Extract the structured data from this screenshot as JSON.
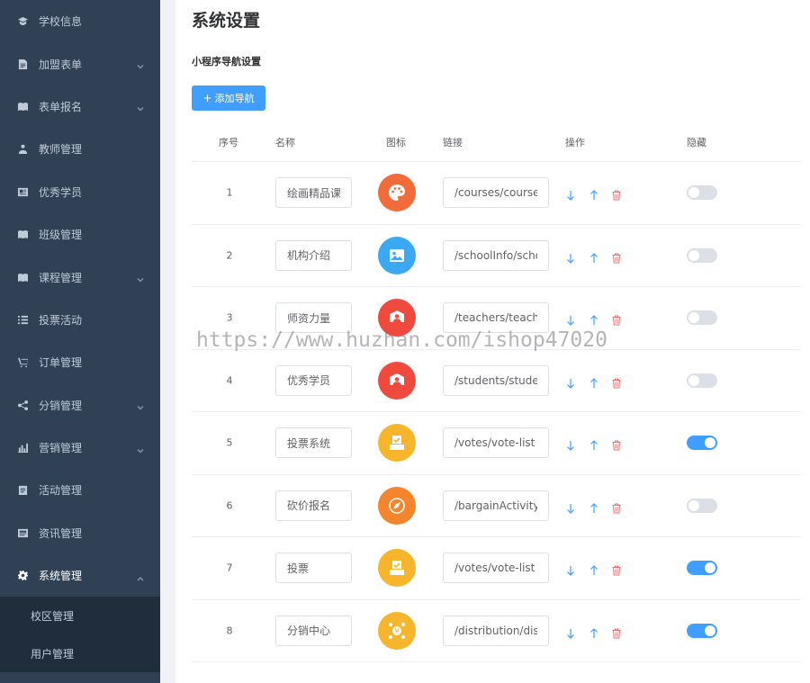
{
  "sidebar": {
    "items": [
      {
        "label": "学校信息",
        "icon": "graduation-cap-icon",
        "has_children": false
      },
      {
        "label": "加盟表单",
        "icon": "form-icon",
        "has_children": true
      },
      {
        "label": "表单报名",
        "icon": "book-open-icon",
        "has_children": true
      },
      {
        "label": "教师管理",
        "icon": "users-icon",
        "has_children": false
      },
      {
        "label": "优秀学员",
        "icon": "id-card-icon",
        "has_children": false
      },
      {
        "label": "班级管理",
        "icon": "book-icon",
        "has_children": false
      },
      {
        "label": "课程管理",
        "icon": "book-icon",
        "has_children": true
      },
      {
        "label": "投票活动",
        "icon": "list-icon",
        "has_children": false
      },
      {
        "label": "订单管理",
        "icon": "cart-icon",
        "has_children": false
      },
      {
        "label": "分销管理",
        "icon": "share-icon",
        "has_children": true
      },
      {
        "label": "营销管理",
        "icon": "bar-chart-icon",
        "has_children": true
      },
      {
        "label": "活动管理",
        "icon": "clipboard-icon",
        "has_children": false
      },
      {
        "label": "资讯管理",
        "icon": "newspaper-icon",
        "has_children": false
      },
      {
        "label": "系统管理",
        "icon": "gear-icon",
        "has_children": true,
        "open": true
      }
    ],
    "submenu": [
      {
        "label": "校区管理"
      },
      {
        "label": "用户管理"
      }
    ]
  },
  "main": {
    "title": "系统设置",
    "section_title": "小程序导航设置",
    "add_button": "添加导航",
    "columns": {
      "index": "序号",
      "name": "名称",
      "icon": "图标",
      "link": "链接",
      "actions": "操作",
      "hidden": "隐藏"
    },
    "rows": [
      {
        "index": "1",
        "name": "绘画精品课",
        "icon": "palette-icon",
        "icon_color": "#f26b3a",
        "link": "/courses/course",
        "hidden": false
      },
      {
        "index": "2",
        "name": "机构介绍",
        "icon": "picture-icon",
        "icon_color": "#3aa8f2",
        "link": "/schoolInfo/scho",
        "hidden": false
      },
      {
        "index": "3",
        "name": "师资力量",
        "icon": "teacher-icon",
        "icon_color": "#f04a3e",
        "link": "/teachers/teache",
        "hidden": false
      },
      {
        "index": "4",
        "name": "优秀学员",
        "icon": "teacher-icon",
        "icon_color": "#f04a3e",
        "link": "/students/stude",
        "hidden": false
      },
      {
        "index": "5",
        "name": "投票系统",
        "icon": "vote-box-icon",
        "icon_color": "#f7b52c",
        "link": "/votes/vote-list",
        "hidden": true
      },
      {
        "index": "6",
        "name": "砍价报名",
        "icon": "compass-icon",
        "icon_color": "#f5852c",
        "link": "/bargainActivity",
        "hidden": false
      },
      {
        "index": "7",
        "name": "投票",
        "icon": "vote-box-icon",
        "icon_color": "#f7b52c",
        "link": "/votes/vote-list",
        "hidden": true
      },
      {
        "index": "8",
        "name": "分销中心",
        "icon": "distribution-icon",
        "icon_color": "#f7b52c",
        "link": "/distribution/dis",
        "hidden": true
      }
    ]
  },
  "watermark": "https://www.huzhan.com/ishop47020",
  "colors": {
    "sidebar_bg": "#304156",
    "primary": "#409eff",
    "danger": "#f56c6c"
  }
}
